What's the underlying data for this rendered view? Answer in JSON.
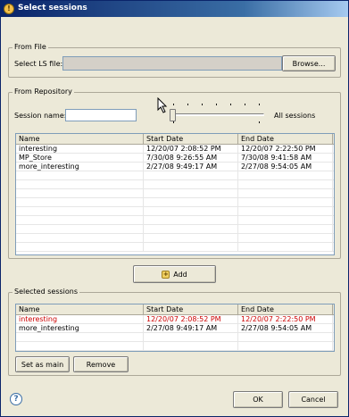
{
  "window": {
    "title": "Select sessions",
    "app_icon": "warning-app-icon"
  },
  "from_file": {
    "legend": "From File",
    "select_label": "Select LS file:",
    "file_value": "",
    "browse_label": "Browse..."
  },
  "from_repository": {
    "legend": "From Repository",
    "session_name_label": "Session name:",
    "session_name_value": "",
    "slider_label": "All sessions",
    "slider_position": 0,
    "columns": [
      "Name",
      "Start Date",
      "End Date"
    ],
    "rows": [
      [
        "interesting",
        "12/20/07 2:08:52 PM",
        "12/20/07 2:22:50 PM"
      ],
      [
        "MP_Store",
        "7/30/08 9:26:55 AM",
        "7/30/08 9:41:58 AM"
      ],
      [
        "more_interesting",
        "2/27/08 9:49:17 AM",
        "2/27/08 9:54:05 AM"
      ]
    ]
  },
  "add_button": {
    "label": "Add",
    "icon": "add-icon"
  },
  "selected_sessions": {
    "legend": "Selected sessions",
    "columns": [
      "Name",
      "Start Date",
      "End Date"
    ],
    "rows": [
      [
        "interesting",
        "12/20/07 2:08:52 PM",
        "12/20/07 2:22:50 PM"
      ],
      [
        "more_interesting",
        "2/27/08 9:49:17 AM",
        "2/27/08 9:54:05 AM"
      ]
    ],
    "highlight_color": "#cc0000",
    "set_as_main_label": "Set as main",
    "remove_label": "Remove"
  },
  "footer": {
    "ok_label": "OK",
    "cancel_label": "Cancel",
    "help_icon": "help-icon"
  }
}
